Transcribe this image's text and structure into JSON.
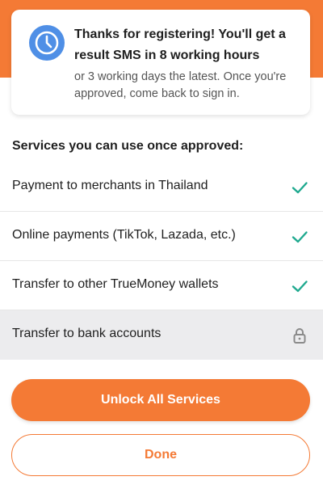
{
  "notice": {
    "icon": "clock-icon",
    "title": "Thanks for registering! You'll get a result SMS in 8 working hours",
    "body": "or 3 working days the latest. Once you're approved, come back to sign in."
  },
  "services": {
    "heading": "Services you can use once approved:",
    "items": [
      {
        "label": "Payment to merchants in Thailand",
        "status": "available",
        "icon": "check-icon"
      },
      {
        "label": "Online payments (TikTok, Lazada, etc.)",
        "status": "available",
        "icon": "check-icon"
      },
      {
        "label": "Transfer to other TrueMoney wallets",
        "status": "available",
        "icon": "check-icon"
      },
      {
        "label": "Transfer to bank accounts",
        "status": "locked",
        "icon": "lock-icon"
      }
    ]
  },
  "actions": {
    "unlock_label": "Unlock All Services",
    "done_label": "Done"
  },
  "colors": {
    "accent": "#f47a35",
    "clock_blue": "#4f8fe6",
    "check_green": "#1fa98f",
    "lock_gray": "#8a8a8a",
    "locked_row_bg": "#ececee"
  }
}
